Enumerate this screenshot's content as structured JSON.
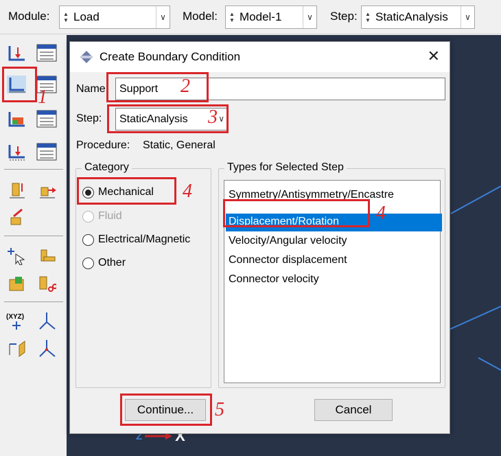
{
  "context_bar": {
    "module_label": "Module:",
    "module_value": "Load",
    "model_label": "Model:",
    "model_value": "Model-1",
    "step_label": "Step:",
    "step_value": "StaticAnalysis"
  },
  "dialog": {
    "title": "Create Boundary Condition",
    "name_label": "Name:",
    "name_value": "Support",
    "step_label": "Step:",
    "step_value": "StaticAnalysis",
    "procedure_label": "Procedure:",
    "procedure_value": "Static, General",
    "category": {
      "title": "Category",
      "options": [
        "Mechanical",
        "Fluid",
        "Electrical/Magnetic",
        "Other"
      ],
      "selected": "Mechanical",
      "disabled": [
        "Fluid"
      ]
    },
    "types": {
      "title": "Types for Selected Step",
      "items": [
        "Symmetry/Antisymmetry/Encastre",
        "Displacement/Rotation",
        "Velocity/Angular velocity",
        "Connector displacement",
        "Connector velocity"
      ],
      "selected": "Displacement/Rotation"
    },
    "continue_label": "Continue...",
    "cancel_label": "Cancel"
  },
  "annotations": [
    "1",
    "2",
    "3",
    "4",
    "4",
    "5"
  ],
  "triad": {
    "x_label": "X",
    "z_label": "Z"
  },
  "colors": {
    "annotation_red": "#d9262b",
    "selection_blue": "#0078d7",
    "viewport_bg": "#283348"
  }
}
